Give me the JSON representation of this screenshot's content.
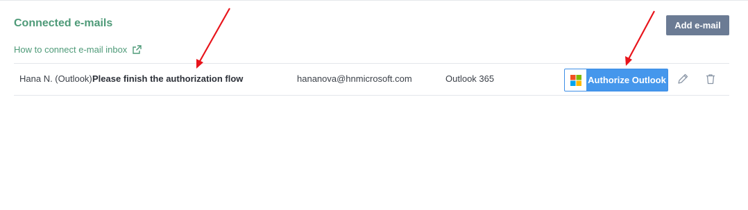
{
  "header": {
    "title": "Connected e-mails",
    "help_link": "How to connect e-mail inbox",
    "add_button": "Add e-mail"
  },
  "rows": [
    {
      "name": "Hana N. (Outlook)",
      "warning": "Please finish the authorization flow",
      "email": "hananova@hnmicrosoft.com",
      "provider": "Outlook 365",
      "authorize_label": "Authorize Outlook"
    }
  ],
  "icons": {
    "help_link_icon": "external-link-icon",
    "auth_icon": "microsoft-logo-icon",
    "edit_icon": "pencil-icon",
    "delete_icon": "trash-icon"
  },
  "colors": {
    "accent_green": "#4e9a78",
    "add_button_bg": "#6b7b94",
    "authorize_blue": "#4597ec",
    "annotation_arrow": "#e8141b"
  }
}
